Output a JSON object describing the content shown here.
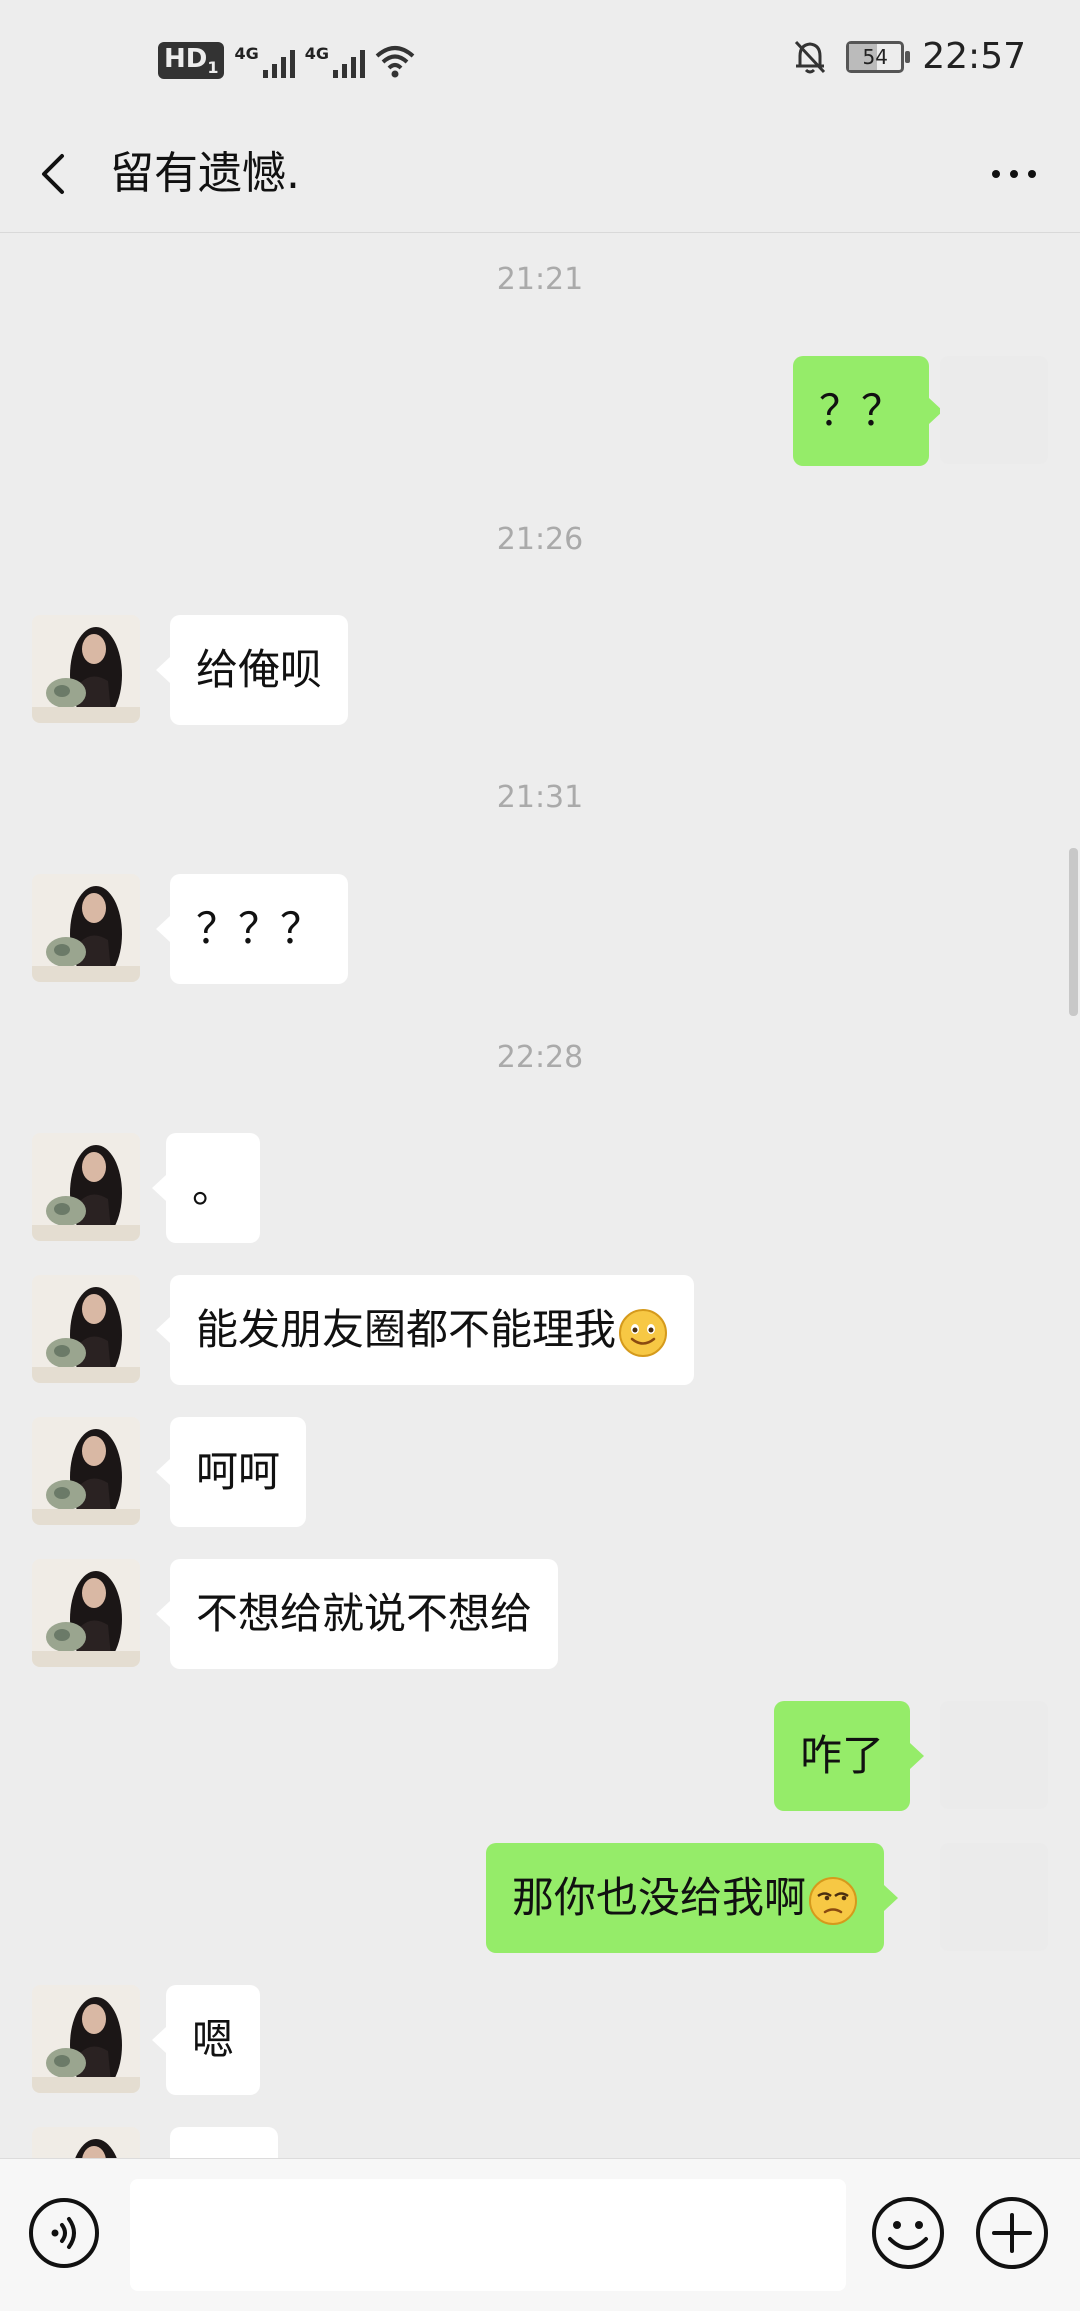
{
  "status": {
    "time": "22:57",
    "battery": "54",
    "network_1": "4G",
    "network_2": "4G",
    "hd": "HD",
    "sim": "1"
  },
  "header": {
    "title": "留有遗憾."
  },
  "chat": {
    "timestamps": [
      "21:21",
      "21:26",
      "21:31",
      "22:28"
    ],
    "messages": [
      {
        "side": "out",
        "text": "？？"
      },
      {
        "side": "in",
        "text": "给俺呗"
      },
      {
        "side": "in",
        "text": "？？？"
      },
      {
        "side": "in",
        "text": "。"
      },
      {
        "side": "in",
        "text": "能发朋友圈都不能理我"
      },
      {
        "side": "in",
        "text": "呵呵"
      },
      {
        "side": "in",
        "text": "不想给就说不想给"
      },
      {
        "side": "out",
        "text": "咋了"
      },
      {
        "side": "out",
        "text": "那你也没给我啊"
      },
      {
        "side": "in",
        "text": "嗯"
      }
    ]
  },
  "composer": {
    "value": ""
  }
}
